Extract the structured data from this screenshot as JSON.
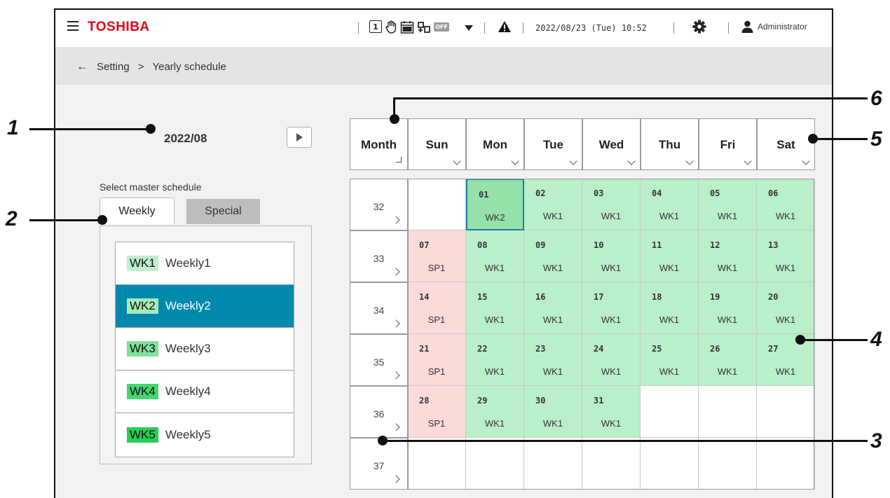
{
  "header": {
    "brand": "TOSHIBA",
    "status_icons": [
      "1",
      "hand",
      "cal-off",
      "ctrl",
      "OFF"
    ],
    "datetime": "2022/08/23 (Tue) 10:52",
    "user_name": "Administrator"
  },
  "breadcrumb": {
    "parent": "Setting",
    "separator": ">",
    "current": "Yearly schedule"
  },
  "year_month": "2022/08",
  "select_label": "Select master schedule",
  "tabs": {
    "weekly": "Weekly",
    "special": "Special"
  },
  "weekly_list": [
    {
      "code": "WK1",
      "name": "Weekly1"
    },
    {
      "code": "WK2",
      "name": "Weekly2"
    },
    {
      "code": "WK3",
      "name": "Weekly3"
    },
    {
      "code": "WK4",
      "name": "Weekly4"
    },
    {
      "code": "WK5",
      "name": "Weekly5"
    }
  ],
  "calendar": {
    "month_header": "Month",
    "day_headers": [
      "Sun",
      "Mon",
      "Tue",
      "Wed",
      "Thu",
      "Fri",
      "Sat"
    ],
    "weeks": [
      {
        "num": "32",
        "days": [
          {
            "d": "",
            "s": "",
            "t": "none"
          },
          {
            "d": "01",
            "s": "WK2",
            "t": "wk",
            "selected": true
          },
          {
            "d": "02",
            "s": "WK1",
            "t": "wk"
          },
          {
            "d": "03",
            "s": "WK1",
            "t": "wk"
          },
          {
            "d": "04",
            "s": "WK1",
            "t": "wk"
          },
          {
            "d": "05",
            "s": "WK1",
            "t": "wk"
          },
          {
            "d": "06",
            "s": "WK1",
            "t": "wk"
          }
        ]
      },
      {
        "num": "33",
        "days": [
          {
            "d": "07",
            "s": "SP1",
            "t": "sp"
          },
          {
            "d": "08",
            "s": "WK1",
            "t": "wk"
          },
          {
            "d": "09",
            "s": "WK1",
            "t": "wk"
          },
          {
            "d": "10",
            "s": "WK1",
            "t": "wk"
          },
          {
            "d": "11",
            "s": "WK1",
            "t": "wk"
          },
          {
            "d": "12",
            "s": "WK1",
            "t": "wk"
          },
          {
            "d": "13",
            "s": "WK1",
            "t": "wk"
          }
        ]
      },
      {
        "num": "34",
        "days": [
          {
            "d": "14",
            "s": "SP1",
            "t": "sp"
          },
          {
            "d": "15",
            "s": "WK1",
            "t": "wk"
          },
          {
            "d": "16",
            "s": "WK1",
            "t": "wk"
          },
          {
            "d": "17",
            "s": "WK1",
            "t": "wk"
          },
          {
            "d": "18",
            "s": "WK1",
            "t": "wk"
          },
          {
            "d": "19",
            "s": "WK1",
            "t": "wk"
          },
          {
            "d": "20",
            "s": "WK1",
            "t": "wk"
          }
        ]
      },
      {
        "num": "35",
        "days": [
          {
            "d": "21",
            "s": "SP1",
            "t": "sp"
          },
          {
            "d": "22",
            "s": "WK1",
            "t": "wk"
          },
          {
            "d": "23",
            "s": "WK1",
            "t": "wk"
          },
          {
            "d": "24",
            "s": "WK1",
            "t": "wk"
          },
          {
            "d": "25",
            "s": "WK1",
            "t": "wk"
          },
          {
            "d": "26",
            "s": "WK1",
            "t": "wk"
          },
          {
            "d": "27",
            "s": "WK1",
            "t": "wk"
          }
        ]
      },
      {
        "num": "36",
        "days": [
          {
            "d": "28",
            "s": "SP1",
            "t": "sp"
          },
          {
            "d": "29",
            "s": "WK1",
            "t": "wk"
          },
          {
            "d": "30",
            "s": "WK1",
            "t": "wk"
          },
          {
            "d": "31",
            "s": "WK1",
            "t": "wk"
          },
          {
            "d": "",
            "s": "",
            "t": "none"
          },
          {
            "d": "",
            "s": "",
            "t": "none"
          },
          {
            "d": "",
            "s": "",
            "t": "none"
          }
        ]
      },
      {
        "num": "37",
        "days": [
          {
            "d": "",
            "s": "",
            "t": "none"
          },
          {
            "d": "",
            "s": "",
            "t": "none"
          },
          {
            "d": "",
            "s": "",
            "t": "none"
          },
          {
            "d": "",
            "s": "",
            "t": "none"
          },
          {
            "d": "",
            "s": "",
            "t": "none"
          },
          {
            "d": "",
            "s": "",
            "t": "none"
          },
          {
            "d": "",
            "s": "",
            "t": "none"
          }
        ]
      }
    ]
  },
  "callouts": {
    "c1": "1",
    "c2": "2",
    "c3": "3",
    "c4": "4",
    "c5": "5",
    "c6": "6"
  },
  "colors": {
    "brand_red": "#e60012",
    "weekly_green": "#b9efc9",
    "special_pink": "#fbdada",
    "selected_blue": "#0088ad",
    "wk1_tag": "#bdf0cb",
    "wk2_tag": "#a5ebb7",
    "wk3_tag": "#7fe29a",
    "wk4_tag": "#45d66f",
    "wk5_tag": "#25cf55"
  }
}
